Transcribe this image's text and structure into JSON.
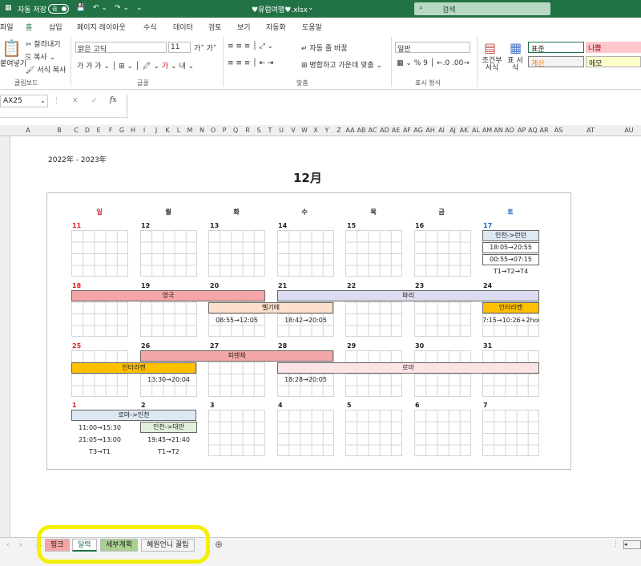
{
  "titlebar": {
    "autosave_label": "자동 저장",
    "toggle_state": "끔",
    "filename": "♥유럽여행♥.xlsx",
    "search_placeholder": "검색"
  },
  "ribbon_tabs": [
    "파일",
    "홈",
    "삽입",
    "페이지 레이아웃",
    "수식",
    "데이터",
    "검토",
    "보기",
    "자동화",
    "도움말"
  ],
  "ribbon": {
    "paste": "붙여넣기",
    "cut": "잘라내기",
    "copy": "복사",
    "format_painter": "서식 복사",
    "clipboard_group": "클립보드",
    "font_name": "맑은 고딕",
    "font_size": "11",
    "font_group": "글꼴",
    "wrap_text": "자동 줄 바꿈",
    "merge_center": "병합하고 가운데 맞춤",
    "align_group": "맞춤",
    "number_format": "일반",
    "number_group": "표시 형식",
    "conditional": "조건부 서식",
    "table_format": "표 서식",
    "style_normal": "표준",
    "style_bad": "나쁨",
    "style_calc": "계산",
    "style_memo": "메모"
  },
  "formula_bar": {
    "namebox": "AX25",
    "fx": "fx",
    "content": ""
  },
  "columns": [
    "A",
    "B",
    "C",
    "D",
    "E",
    "F",
    "G",
    "H",
    "I",
    "J",
    "K",
    "L",
    "M",
    "N",
    "O",
    "P",
    "Q",
    "R",
    "S",
    "T",
    "U",
    "V",
    "W",
    "X",
    "Y",
    "Z",
    "AA",
    "AB",
    "AC",
    "AD",
    "AE",
    "AF",
    "AG",
    "AH",
    "AI",
    "AJ",
    "AK",
    "AL",
    "AM",
    "AN",
    "AO",
    "AP",
    "AQ",
    "AR",
    "AS",
    "AT",
    "AU"
  ],
  "calendar": {
    "year_label": "2022年 - 2023年",
    "month_title": "12月",
    "weekdays": [
      "일",
      "월",
      "화",
      "수",
      "목",
      "금",
      "토"
    ],
    "weeks": [
      [
        "11",
        "12",
        "13",
        "14",
        "15",
        "16",
        "17"
      ],
      [
        "18",
        "19",
        "20",
        "21",
        "22",
        "23",
        "24"
      ],
      [
        "25",
        "26",
        "27",
        "28",
        "29",
        "30",
        "31"
      ],
      [
        "1",
        "2",
        "3",
        "4",
        "5",
        "6",
        "7"
      ]
    ],
    "events": {
      "incheon_london": "인천->런던",
      "time_1": "18:05→20:55",
      "time_2": "00:55→07:15",
      "terminals_1": "T1→T2→T4",
      "uk": "영국",
      "paris": "파리",
      "belgium": "벨기에",
      "interlaken_1": "인터라켄",
      "time_3": "08:55→12:05",
      "time_4": "18:42→20:05",
      "time_5": "7:15→10:26+2hour",
      "florence": "피렌체",
      "interlaken_2": "인터라켄",
      "rome": "로마",
      "time_6": "13:30→20:04",
      "time_7": "18:28→20:05",
      "rome_incheon": "로마->인천",
      "incheon_taipei": "인천->대만",
      "time_8": "11:00→15:30",
      "time_9": "21:05→13:00",
      "terminals_2": "T3→T1",
      "time_10": "19:45→21:40",
      "terminals_3": "T1→T2"
    }
  },
  "sheet_tabs": [
    "핑크",
    "달력",
    "세부계획",
    "혜원언니 꿀팁"
  ],
  "colors": {
    "excel_green": "#217346",
    "sunday_red": "#e02020",
    "saturday_blue": "#2060c0",
    "bar_pink": "#f4a6a6",
    "bar_lavender": "#dcdcf0",
    "bar_peach": "#fde0cc",
    "bar_orange": "#ffc000",
    "bar_lightblue": "#dde8f3",
    "bar_lightgreen": "#e2efda",
    "bar_lightpink": "#fce4e6",
    "highlight_yellow": "#f5ef00"
  }
}
